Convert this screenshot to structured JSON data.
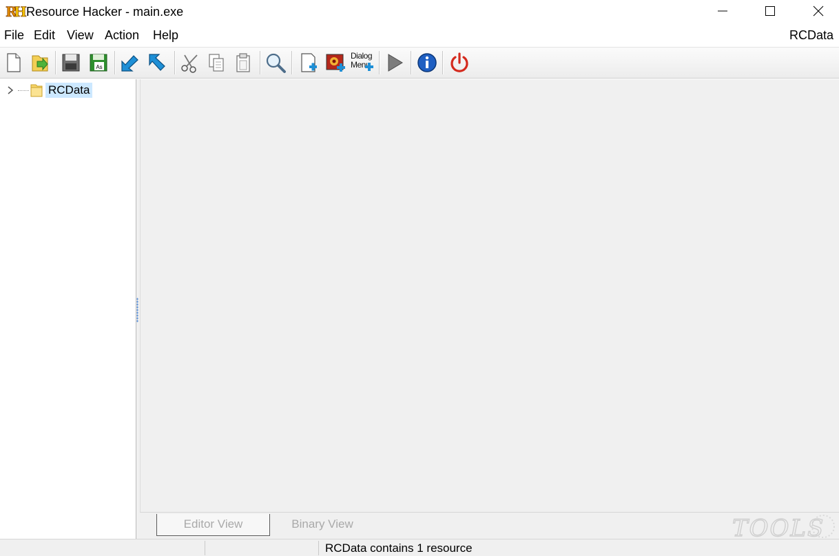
{
  "window": {
    "logo_text": "RH",
    "title": "Resource Hacker - main.exe"
  },
  "menu": {
    "items": [
      "File",
      "Edit",
      "View",
      "Action",
      "Help"
    ],
    "right_label": "RCData"
  },
  "toolbar": {
    "buttons": [
      "new-file-icon",
      "open-file-icon",
      "save-icon",
      "save-as-icon",
      "back-arrow-icon",
      "forward-arrow-icon",
      "cut-icon",
      "copy-icon",
      "paste-icon",
      "search-icon",
      "add-resource-icon",
      "add-image-resource-icon",
      "dialog-menu-icon",
      "run-script-icon",
      "info-icon",
      "power-icon"
    ],
    "save_as_label": "As",
    "dialog_menu_label_1": "Dialog",
    "dialog_menu_label_2": "Menu"
  },
  "tree": {
    "items": [
      {
        "label": "RCData",
        "expanded": false,
        "selected": true
      }
    ]
  },
  "editor": {
    "tabs": [
      "Editor View",
      "Binary View"
    ],
    "active_tab": "Editor View",
    "watermark_text": "TOOLS"
  },
  "status": {
    "text": "RCData contains 1 resource"
  },
  "colors": {
    "selection": "#cce8ff",
    "pane_background": "#f0f0f0",
    "arrow_blue": "#1e8fd6",
    "power_red": "#d42a1e",
    "info_blue": "#1f5fc2"
  }
}
